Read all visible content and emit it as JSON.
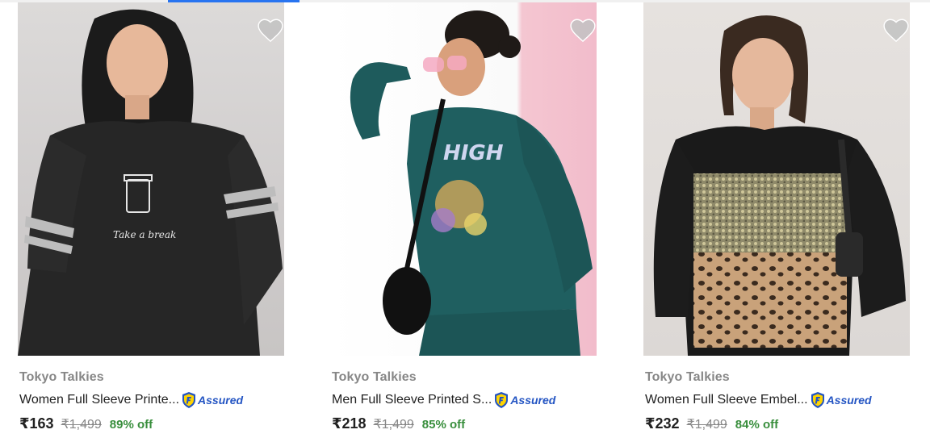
{
  "products": [
    {
      "brand": "Tokyo Talkies",
      "title": "Women Full Sleeve Printe...",
      "assured": "Assured",
      "price": "₹163",
      "mrp": "₹1,499",
      "discount": "89% off"
    },
    {
      "brand": "Tokyo Talkies",
      "title": "Men Full Sleeve Printed S...",
      "assured": "Assured",
      "price": "₹218",
      "mrp": "₹1,499",
      "discount": "85% off"
    },
    {
      "brand": "Tokyo Talkies",
      "title": "Women Full Sleeve Embel...",
      "assured": "Assured",
      "price": "₹232",
      "mrp": "₹1,499",
      "discount": "84% off"
    }
  ],
  "icons": {
    "wishlist": "heart-icon",
    "assured": "assured-shield-icon"
  },
  "colors": {
    "price_text": "#212121",
    "mrp_text": "#878787",
    "discount_text": "#388e3c",
    "assured_text": "#2455c3",
    "wishlist_heart": "#c2c2c2"
  }
}
